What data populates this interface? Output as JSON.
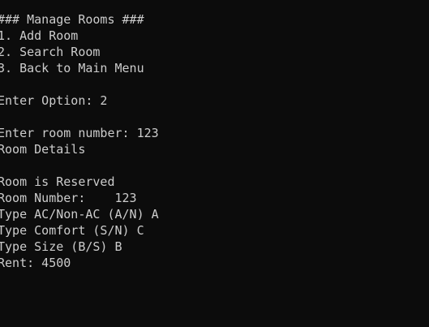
{
  "console": {
    "background": "#0c0c0c",
    "foreground": "#cccccc",
    "lines": [
      "### Manage Rooms ###",
      "1. Add Room",
      "2. Search Room",
      "3. Back to Main Menu",
      "",
      "Enter Option: 2",
      "",
      "Enter room number: 123",
      "Room Details",
      "",
      "Room is Reserved",
      "Room Number:    123",
      "Type AC/Non-AC (A/N) A",
      "Type Comfort (S/N) C",
      "Type Size (B/S) B",
      "Rent: 4500"
    ]
  }
}
